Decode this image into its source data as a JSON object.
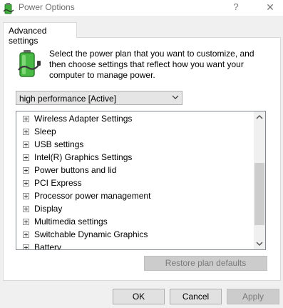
{
  "window": {
    "title": "Power Options",
    "help_label": "?",
    "close_label": "✕"
  },
  "tab": {
    "label": "Advanced settings"
  },
  "description": "Select the power plan that you want to customize, and then choose settings that reflect how you want your computer to manage power.",
  "plan_select": {
    "value": "high performance [Active]"
  },
  "tree": {
    "items": [
      "Wireless Adapter Settings",
      "Sleep",
      "USB settings",
      "Intel(R) Graphics Settings",
      "Power buttons and lid",
      "PCI Express",
      "Processor power management",
      "Display",
      "Multimedia settings",
      "Switchable Dynamic Graphics",
      "Battery"
    ]
  },
  "buttons": {
    "restore": "Restore plan defaults",
    "ok": "OK",
    "cancel": "Cancel",
    "apply": "Apply"
  }
}
